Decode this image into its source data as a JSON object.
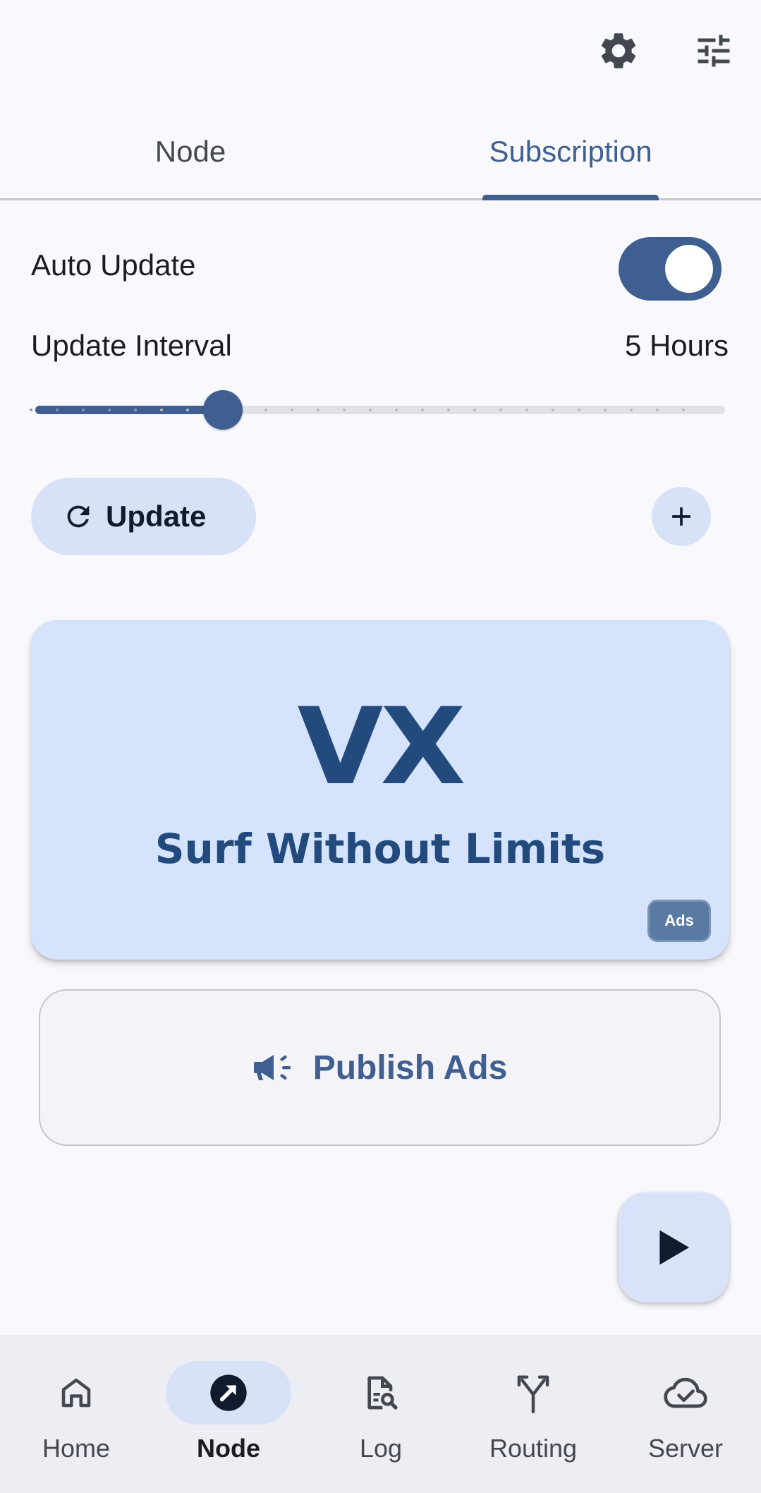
{
  "top_bar": {
    "icons": [
      "gear-icon",
      "tune-sliders-icon"
    ]
  },
  "tabs": [
    {
      "label": "Node",
      "selected": false
    },
    {
      "label": "Subscription",
      "selected": true
    }
  ],
  "subscription": {
    "auto_update": {
      "label": "Auto Update",
      "enabled": true
    },
    "update_interval": {
      "label": "Update Interval",
      "value_text": "5 Hours",
      "value": 5,
      "steps": 26
    },
    "update_button_label": "Update",
    "add_button_icon": "plus-icon"
  },
  "ad": {
    "logo": "VX",
    "tagline": "Surf Without Limits",
    "badge": "Ads"
  },
  "publish_ads_label": "Publish Ads",
  "fab_icon": "play-icon",
  "bottom_nav": [
    {
      "label": "Home",
      "icon": "home-icon",
      "active": false
    },
    {
      "label": "Node",
      "icon": "navigation-arrow-icon",
      "active": true
    },
    {
      "label": "Log",
      "icon": "log-search-icon",
      "active": false
    },
    {
      "label": "Routing",
      "icon": "routing-fork-icon",
      "active": false
    },
    {
      "label": "Server",
      "icon": "cloud-check-icon",
      "active": false
    }
  ],
  "colors": {
    "accent": "#3e5f90",
    "background": "#f9f9fd",
    "ad_card": "#d5e3fc",
    "ad_text": "#234a7d",
    "nav_bar": "#ededf4"
  }
}
